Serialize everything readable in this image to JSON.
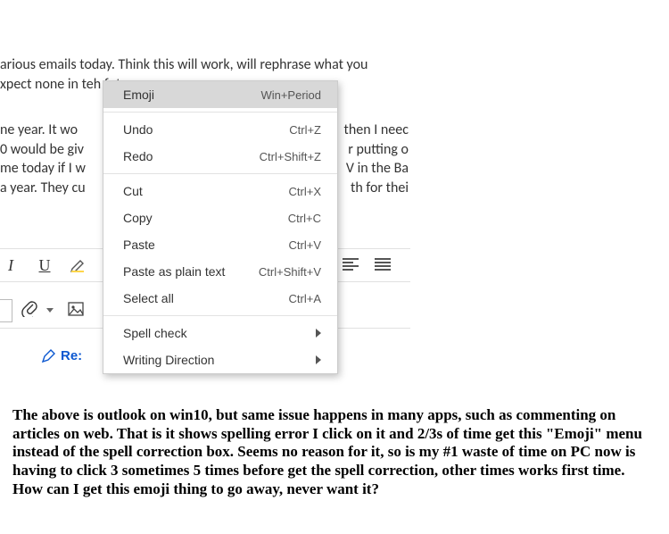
{
  "doc": {
    "line1": "arious emails today.  Think this will work, will rephrase what you",
    "line2_pre": "xpect none in ",
    "line2_err": "teh",
    "line2_post": " future",
    "p2_l1a": "ne year. It wo",
    "p2_l1b": "then I neec",
    "p2_l2a": "0 would be giv",
    "p2_l2b": "r putting o",
    "p2_l3a": "me today if I w",
    "p2_l3b": "V in the Ba",
    "p2_l4a": "a year.  They cu",
    "p2_l4b": "th for thei"
  },
  "menu": {
    "emoji": "Emoji",
    "emoji_sc": "Win+Period",
    "undo": "Undo",
    "undo_sc": "Ctrl+Z",
    "redo": "Redo",
    "redo_sc": "Ctrl+Shift+Z",
    "cut": "Cut",
    "cut_sc": "Ctrl+X",
    "copy": "Copy",
    "copy_sc": "Ctrl+C",
    "paste": "Paste",
    "paste_sc": "Ctrl+V",
    "paste_plain": "Paste as plain text",
    "paste_plain_sc": "Ctrl+Shift+V",
    "select_all": "Select all",
    "select_all_sc": "Ctrl+A",
    "spell": "Spell check",
    "writing": "Writing Direction"
  },
  "subject": {
    "re": "Re:"
  },
  "caption": "The above is outlook on win10, but same issue happens in many apps, such as commenting on articles on web.  That is it shows spelling error I click on it and 2/3s of time get this \"Emoji\" menu instead of the spell correction box. Seems no reason for it, so is my #1 waste of time on PC now is having to click 3 sometimes 5 times before get the spell correction, other times works first time.  How can I get this emoji thing to go away, never want it?"
}
